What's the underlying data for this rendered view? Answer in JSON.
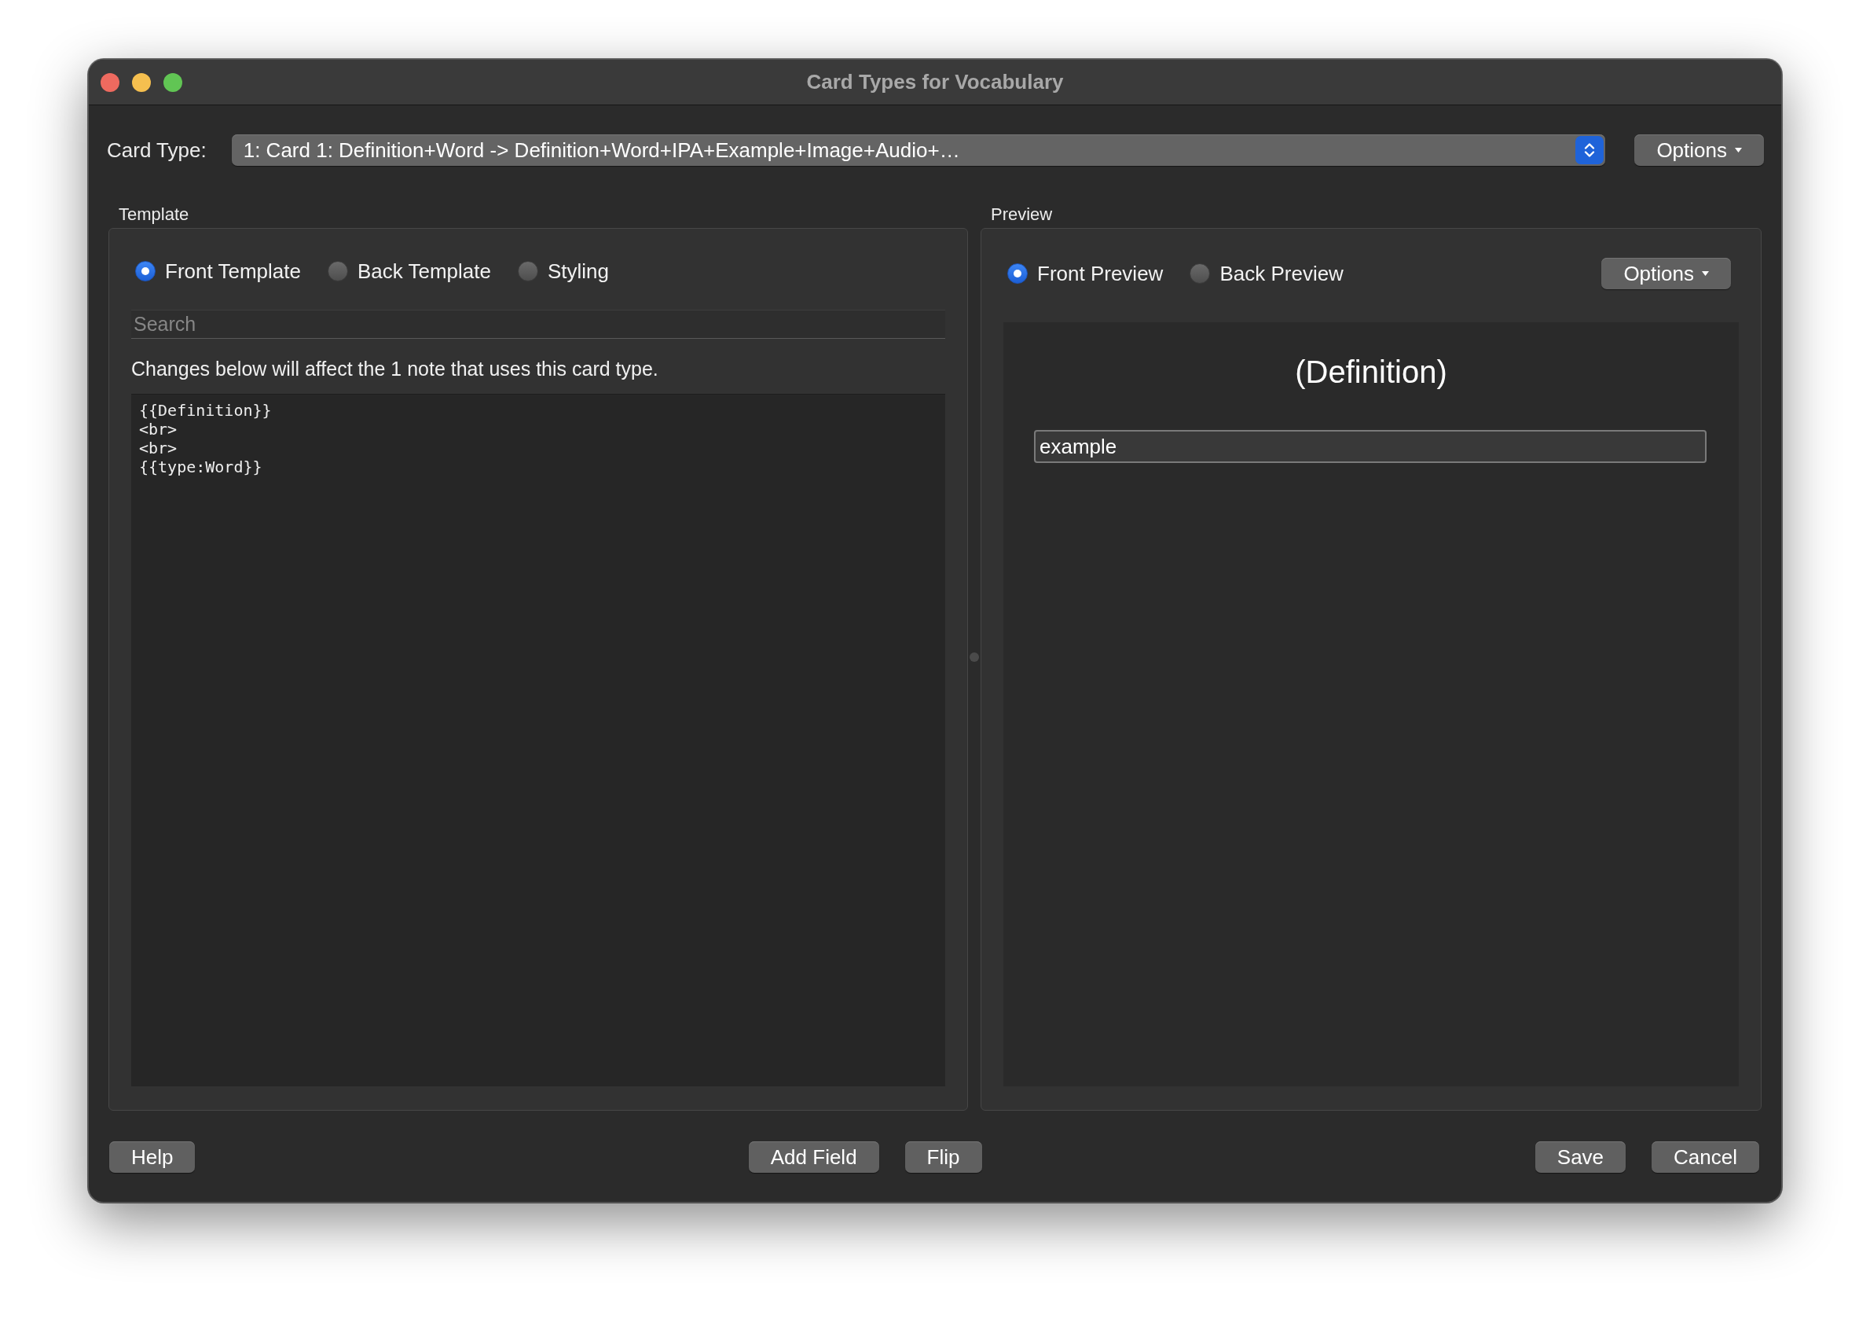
{
  "window": {
    "title": "Card Types for Vocabulary"
  },
  "card_type": {
    "label": "Card Type:",
    "value": "1: Card 1: Definition+Word -> Definition+Word+IPA+Example+Image+Audio+…",
    "options_button": "Options"
  },
  "template": {
    "title": "Template",
    "modes": [
      {
        "label": "Front Template",
        "selected": true
      },
      {
        "label": "Back Template",
        "selected": false
      },
      {
        "label": "Styling",
        "selected": false
      }
    ],
    "search": {
      "placeholder": "Search"
    },
    "notice": "Changes below will affect the 1 note that uses this card type.",
    "code": [
      "{{Definition}}",
      "<br>",
      "<br>",
      "{{type:Word}}"
    ]
  },
  "preview": {
    "title": "Preview",
    "modes": [
      {
        "label": "Front Preview",
        "selected": true
      },
      {
        "label": "Back Preview",
        "selected": false
      }
    ],
    "options_button": "Options",
    "card": {
      "front_text": "(Definition)",
      "answer_input": {
        "value": "example"
      }
    }
  },
  "footer": {
    "left_buttons": [
      "Help"
    ],
    "middle_buttons": [
      "Add Field",
      "Flip"
    ],
    "right_buttons": [
      "Save",
      "Cancel"
    ]
  }
}
